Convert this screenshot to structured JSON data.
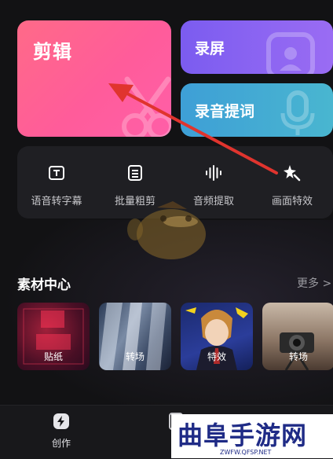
{
  "cards": {
    "edit": {
      "title": "剪辑"
    },
    "record": {
      "title": "录屏"
    },
    "teleprompter": {
      "title": "录音提词"
    }
  },
  "tools": [
    {
      "label": "语音转字幕",
      "icon": "caption-icon"
    },
    {
      "label": "批量粗剪",
      "icon": "list-icon"
    },
    {
      "label": "音频提取",
      "icon": "waveform-icon"
    },
    {
      "label": "画面特效",
      "icon": "magic-star-icon"
    }
  ],
  "materials": {
    "title": "素材中心",
    "more": "更多 >",
    "items": [
      {
        "label": "贴纸"
      },
      {
        "label": "转场"
      },
      {
        "label": "特效"
      },
      {
        "label": "转场"
      }
    ]
  },
  "bottom_nav": {
    "create": "创作"
  },
  "watermark": {
    "title": "曲阜手游网",
    "url": "ZWFW.QFSP.NET"
  },
  "colors": {
    "edit_card": "#ff6a88",
    "record_card": "#8a64f2",
    "teleprompter_card": "#44a9d4",
    "arrow": "#e0342e"
  }
}
